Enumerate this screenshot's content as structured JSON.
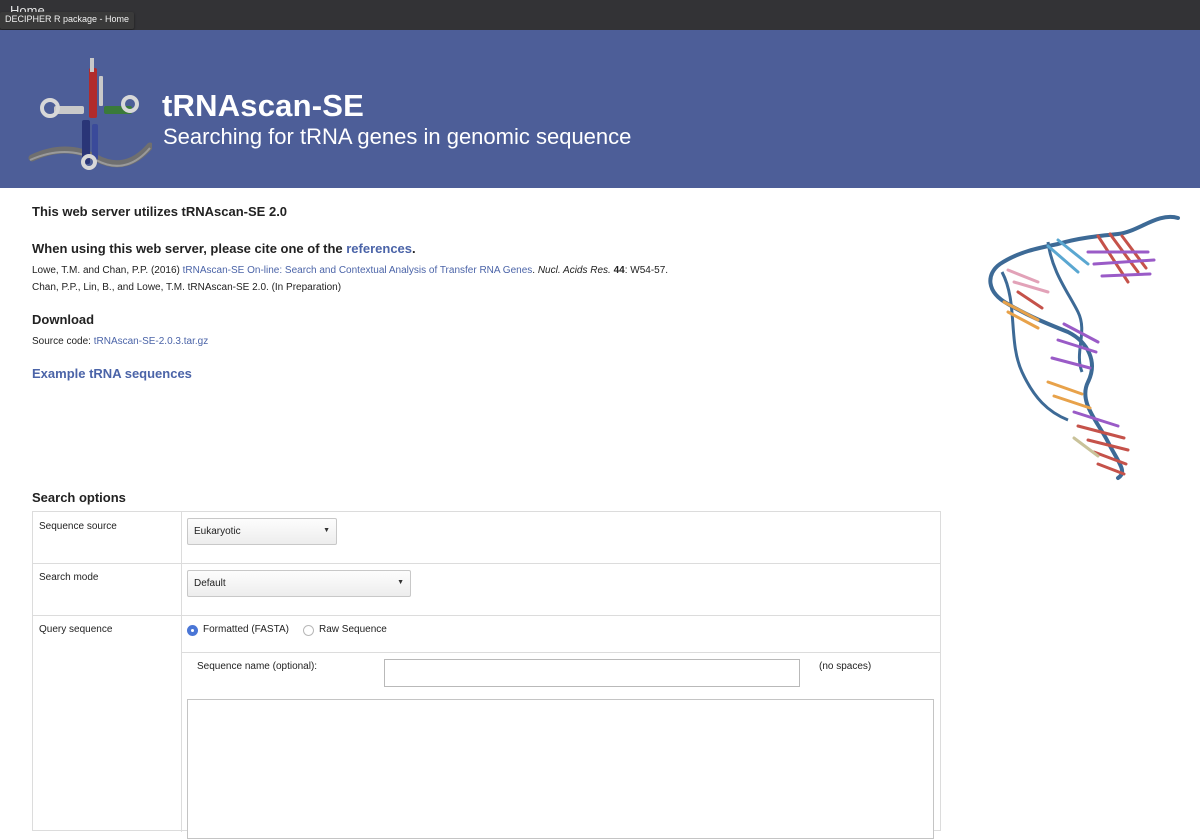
{
  "browser": {
    "ghost_title": "Home",
    "tooltip": "DECIPHER R package - Home"
  },
  "header": {
    "title": "tRNAscan-SE",
    "subtitle": "Searching for tRNA genes in genomic sequence"
  },
  "intro": {
    "utilizes": "This web server utilizes tRNAscan-SE 2.0",
    "cite_prefix": "When using this web server, please cite one of the ",
    "cite_link": "references",
    "cite_suffix": ".",
    "ref1": {
      "authors": "Lowe, T.M. and Chan, P.P. (2016) ",
      "title_link": "tRNAscan-SE On-line: Search and Contextual Analysis of Transfer RNA Genes",
      "journal_sep": ". ",
      "journal": "Nucl. Acids Res.",
      "volume": "44",
      "pages": ": W54-57."
    },
    "ref2": "Chan, P.P., Lin, B., and Lowe, T.M. tRNAscan-SE 2.0. (In Preparation)"
  },
  "download": {
    "heading": "Download",
    "source_label": "Source code: ",
    "source_link": "tRNAscan-SE-2.0.3.tar.gz"
  },
  "example_link": "Example tRNA sequences",
  "search": {
    "heading": "Search options",
    "sequence_source": {
      "label": "Sequence source",
      "value": "Eukaryotic"
    },
    "search_mode": {
      "label": "Search mode",
      "value": "Default"
    },
    "query": {
      "label": "Query sequence",
      "option_fasta": "Formatted (FASTA)",
      "option_raw": "Raw Sequence",
      "selected": "Formatted (FASTA)",
      "seqname_label": "Sequence name (optional):",
      "seqname_value": "",
      "nospaces": "(no spaces)",
      "sequence_value": ""
    }
  },
  "colors": {
    "banner": "#4d5e98",
    "link": "#4b64a8",
    "radio_on": "#4a76d6"
  }
}
